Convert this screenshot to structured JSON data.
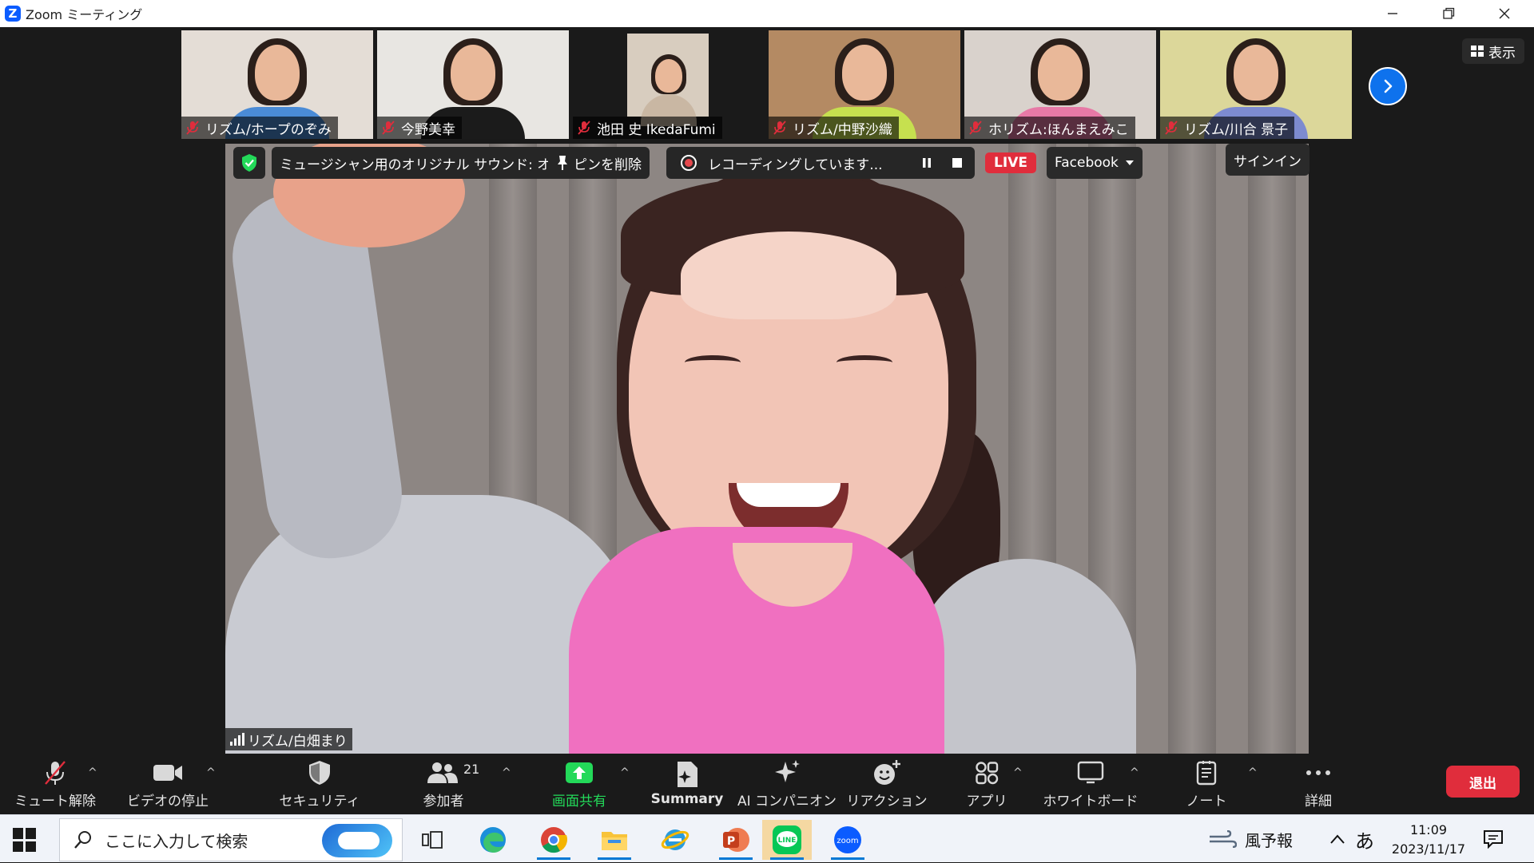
{
  "window": {
    "app_logo": "Z",
    "title": "Zoom ミーティング",
    "minimize_icon": "minimize-icon",
    "restore_icon": "restore-icon",
    "close_icon": "close-icon"
  },
  "gallery": {
    "participants": [
      {
        "name": "リズム/ホープのぞみ",
        "muted": true,
        "bg": "#e4ddd6",
        "shirt": "#4a8bd6"
      },
      {
        "name": "今野美幸",
        "muted": true,
        "bg": "#e8e6e2",
        "shirt": "#1b1b1b"
      },
      {
        "name": "池田 史 IkedaFumi",
        "muted": true,
        "bg": "#d8cdbf",
        "shirt": "#c9b7a3"
      },
      {
        "name": "リズム/中野沙織",
        "muted": true,
        "bg": "#b48a63",
        "shirt": "#c6e04f"
      },
      {
        "name": "ホリズム:ほんまえみこ",
        "muted": true,
        "bg": "#d9d2cc",
        "shirt": "#e779a6"
      },
      {
        "name": "リズム/川合 景子",
        "muted": true,
        "bg": "#dcd79a",
        "shirt": "#7d8bd0"
      }
    ],
    "next_icon": "chevron-right-icon",
    "view_label": "表示"
  },
  "meeting_bar": {
    "security_icon": "shield-check-icon",
    "original_sound": "ミュージシャン用のオリジナル サウンド: オフ",
    "unpin_label": "ピンを削除",
    "recording_text": "レコーディングしています...",
    "pause_icon": "pause-icon",
    "stop_icon": "stop-icon",
    "live_badge": "LIVE",
    "live_platform": "Facebook",
    "signin_label": "サインイン"
  },
  "main_video": {
    "speaker_name": "リズム/白畑まり"
  },
  "toolbar": {
    "items": [
      {
        "label": "ミュート解除",
        "icon": "mic-muted-icon"
      },
      {
        "label": "ビデオの停止",
        "icon": "video-camera-icon"
      },
      {
        "label": "セキュリティ",
        "icon": "shield-icon"
      },
      {
        "label": "参加者",
        "icon": "participants-icon",
        "count": "21"
      },
      {
        "label": "画面共有",
        "icon": "share-screen-icon"
      },
      {
        "label": "Summary",
        "icon": "summary-icon"
      },
      {
        "label": "AI コンパニオン",
        "icon": "ai-sparkle-icon"
      },
      {
        "label": "リアクション",
        "icon": "reaction-icon"
      },
      {
        "label": "アプリ",
        "icon": "apps-icon"
      },
      {
        "label": "ホワイトボード",
        "icon": "whiteboard-icon"
      },
      {
        "label": "ノート",
        "icon": "notes-icon"
      },
      {
        "label": "詳細",
        "icon": "more-icon"
      }
    ],
    "leave_label": "退出",
    "share_color": "#23d959"
  },
  "taskbar": {
    "search_placeholder": "ここに入力して検索",
    "apps": [
      "task-view-icon",
      "edge-icon",
      "chrome-icon",
      "file-explorer-icon",
      "ie-icon",
      "powerpoint-icon",
      "line-icon",
      "zoom-icon"
    ],
    "line_label": "LINE",
    "zoom_label": "zoom",
    "weather": "風予報",
    "ime": "あ",
    "time": "11:09",
    "date": "2023/11/17"
  }
}
